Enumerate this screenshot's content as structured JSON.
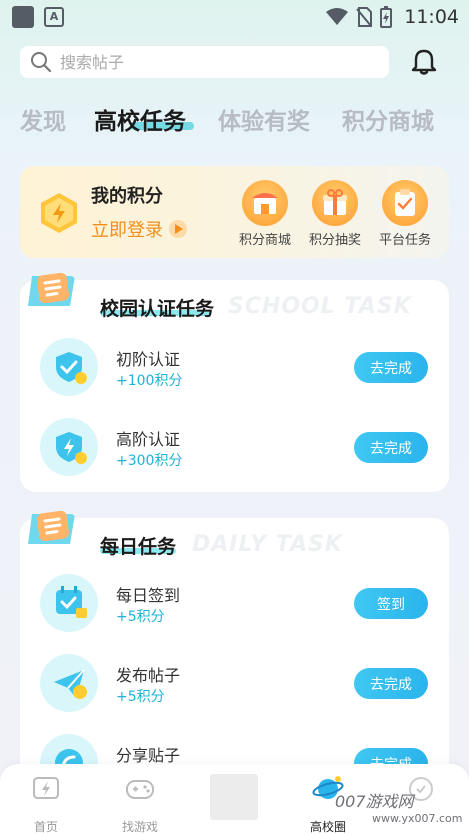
{
  "status_bar": {
    "time": "11:04"
  },
  "search": {
    "placeholder": "搜索帖子"
  },
  "tabs": [
    {
      "label": "发现"
    },
    {
      "label": "高校任务"
    },
    {
      "label": "体验有奖"
    },
    {
      "label": "积分商城"
    }
  ],
  "points_card": {
    "title": "我的积分",
    "login_label": "立即登录",
    "shortcuts": [
      {
        "label": "积分商城",
        "icon": "shop-icon"
      },
      {
        "label": "积分抽奖",
        "icon": "gift-icon"
      },
      {
        "label": "平台任务",
        "icon": "clipboard-icon"
      }
    ]
  },
  "school_tasks": {
    "title": "校园认证任务",
    "bg_text": "SCHOOL TASK",
    "items": [
      {
        "name": "初阶认证",
        "points": "+100积分",
        "button": "去完成"
      },
      {
        "name": "高阶认证",
        "points": "+300积分",
        "button": "去完成"
      }
    ]
  },
  "daily_tasks": {
    "title": "每日任务",
    "bg_text": "DAILY TASK",
    "items": [
      {
        "name": "每日签到",
        "points": "+5积分",
        "button": "签到"
      },
      {
        "name": "发布帖子",
        "points": "+5积分",
        "button": "去完成"
      },
      {
        "name": "分享贴子",
        "points": "",
        "button": "去完成"
      }
    ]
  },
  "bottom_nav": [
    {
      "label": "首页"
    },
    {
      "label": "找游戏"
    },
    {
      "label": "高校圈"
    }
  ],
  "watermark": {
    "text": "007游戏网",
    "sub": "www.yx007.com"
  },
  "colors": {
    "accent": "#2ab4ec",
    "orange": "#f08f1a",
    "points_text": "#1db4d8"
  }
}
